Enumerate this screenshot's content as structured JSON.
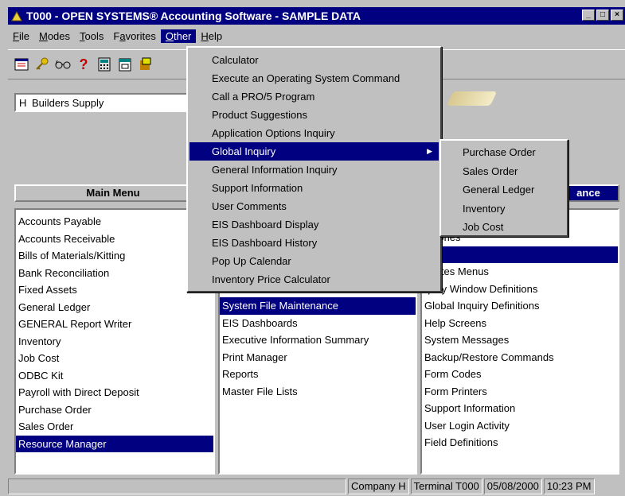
{
  "window": {
    "title": "T000 - OPEN SYSTEMS® Accounting Software - SAMPLE DATA",
    "buttons": [
      "_",
      "□",
      "×"
    ]
  },
  "menubar": {
    "items": [
      {
        "label": "File",
        "ul": "F",
        "rest": "ile"
      },
      {
        "label": "Modes",
        "ul": "M",
        "rest": "odes"
      },
      {
        "label": "Tools",
        "ul": "T",
        "rest": "ools"
      },
      {
        "label": "Favorites",
        "pre": "F",
        "ul": "a",
        "rest": "vorites"
      },
      {
        "label": "Other",
        "ul": "O",
        "rest": "ther"
      },
      {
        "label": "Help",
        "ul": "H",
        "rest": "elp"
      }
    ]
  },
  "toolbar": {
    "icons": [
      "window-icon",
      "key-icon",
      "glasses-icon",
      "help-icon",
      "calculator-icon",
      "calendar-icon",
      "tools-icon"
    ]
  },
  "company": {
    "code": "H",
    "name": "Builders Supply"
  },
  "panels": {
    "main_menu_title": "Main Menu",
    "right_title_fragment": "ance",
    "main_menu": [
      "Accounts Payable",
      "Accounts Receivable",
      "Bills of Materials/Kitting",
      "Bank Reconciliation",
      "Fixed Assets",
      "General Ledger",
      "GENERAL Report Writer",
      "Inventory",
      "Job Cost",
      "ODBC Kit",
      "Payroll with Direct Deposit",
      "Purchase Order",
      "Sales Order",
      "Resource Manager"
    ],
    "main_selected": "Resource Manager",
    "middle": [
      "System File Maintenance",
      "EIS Dashboards",
      "Executive Information Summary",
      "Print Manager",
      "Reports",
      "Master File Lists"
    ],
    "middle_selected": "System File Maintenance",
    "right": [
      "ectories",
      "nus",
      "vorites Menus",
      "quiry Window Definitions",
      "Global Inquiry Definitions",
      "Help Screens",
      "System Messages",
      "Backup/Restore Commands",
      "Form Codes",
      "Form Printers",
      "Support Information",
      "User Login Activity",
      "Field Definitions"
    ],
    "right_selected": "nus"
  },
  "other_menu": {
    "items": [
      "Calculator",
      "Execute an Operating System Command",
      "Call a PRO/5 Program",
      "Product Suggestions",
      "Application Options Inquiry",
      "Global Inquiry",
      "General Information Inquiry",
      "Support Information",
      "User Comments",
      "EIS Dashboard Display",
      "EIS Dashboard History",
      "Pop Up Calendar",
      "Inventory Price Calculator"
    ],
    "highlighted": "Global Inquiry"
  },
  "global_inquiry_submenu": {
    "items": [
      "Purchase Order",
      "Sales Order",
      "General Ledger",
      "Inventory",
      "Job Cost"
    ]
  },
  "status": {
    "company": "Company H",
    "terminal": "Terminal T000",
    "date": "05/08/2000",
    "time": "10:23 PM"
  },
  "colors": {
    "titlebar": "#000080",
    "selection": "#000080",
    "face": "#c0c0c0"
  }
}
